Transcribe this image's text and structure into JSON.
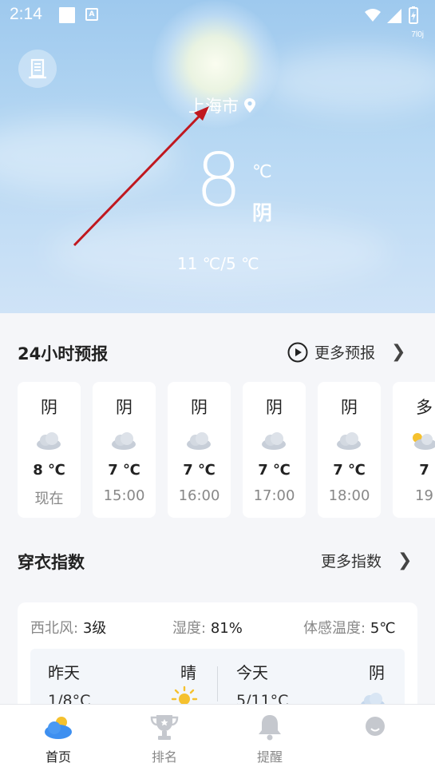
{
  "status_bar": {
    "time": "2:14",
    "network_speed": "7l0j"
  },
  "hero": {
    "city": "上海市",
    "temperature": "8",
    "unit": "℃",
    "condition": "阴",
    "range": "11 ℃/5 ℃"
  },
  "forecast_24h": {
    "title": "24小时预报",
    "more_label": "更多预报",
    "hours": [
      {
        "cond": "阴",
        "temp": "8 ℃",
        "time": "现在",
        "icon": "cloud-icon"
      },
      {
        "cond": "阴",
        "temp": "7 ℃",
        "time": "15:00",
        "icon": "cloud-icon"
      },
      {
        "cond": "阴",
        "temp": "7 ℃",
        "time": "16:00",
        "icon": "cloud-icon"
      },
      {
        "cond": "阴",
        "temp": "7 ℃",
        "time": "17:00",
        "icon": "cloud-icon"
      },
      {
        "cond": "阴",
        "temp": "7 ℃",
        "time": "18:00",
        "icon": "cloud-icon"
      },
      {
        "cond": "多",
        "temp": "7",
        "time": "19",
        "icon": "partly-cloudy-icon"
      }
    ]
  },
  "clothing_index": {
    "title": "穿衣指数",
    "more_label": "更多指数",
    "wind_label": "西北风:",
    "wind_value": "3级",
    "humidity_label": "湿度:",
    "humidity_value": "81%",
    "feels_label": "体感温度:",
    "feels_value": "5℃",
    "yesterday_label": "昨天",
    "yesterday_cond": "晴",
    "yesterday_temp": "1/8°C",
    "today_label": "今天",
    "today_cond": "阴",
    "today_temp": "5/11°C"
  },
  "bottom_nav": {
    "items": [
      {
        "label": "首页",
        "icon": "home-weather-icon",
        "active": true
      },
      {
        "label": "排名",
        "icon": "trophy-icon",
        "active": false
      },
      {
        "label": "提醒",
        "icon": "bell-icon",
        "active": false
      },
      {
        "label": "",
        "icon": "profile-icon",
        "active": false
      }
    ]
  },
  "colors": {
    "sky_top": "#9ec9ee",
    "sky_bottom": "#cfe3f7",
    "annotation_arrow": "#c0181f",
    "sun": "#f5c12e"
  }
}
